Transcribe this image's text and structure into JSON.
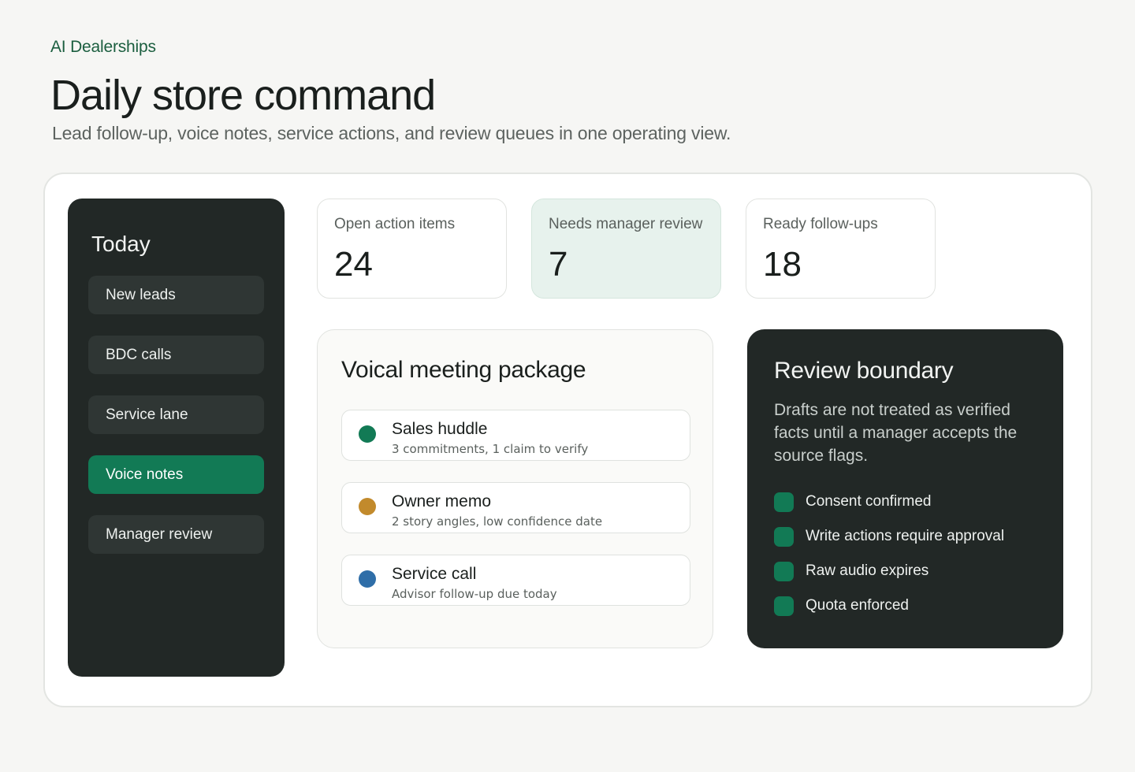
{
  "header": {
    "brand": "AI Dealerships",
    "title": "Daily store command",
    "subtitle": "Lead follow-up, voice notes, service actions, and review queues in one operating view."
  },
  "sidebar": {
    "title": "Today",
    "items": [
      {
        "label": "New leads",
        "active": false
      },
      {
        "label": "BDC calls",
        "active": false
      },
      {
        "label": "Service lane",
        "active": false
      },
      {
        "label": "Voice notes",
        "active": true
      },
      {
        "label": "Manager review",
        "active": false
      }
    ]
  },
  "metrics": [
    {
      "label": "Open action items",
      "value": "24"
    },
    {
      "label": "Needs manager review",
      "value": "7"
    },
    {
      "label": "Ready follow-ups",
      "value": "18"
    }
  ],
  "package": {
    "title": "Voical meeting package",
    "items": [
      {
        "name": "Sales huddle",
        "detail": "3 commitments, 1 claim to verify",
        "dot_color": "#127a55"
      },
      {
        "name": "Owner memo",
        "detail": "2 story angles, low confidence date",
        "dot_color": "#c28a2c"
      },
      {
        "name": "Service call",
        "detail": "Advisor follow-up due today",
        "dot_color": "#2f6ea8"
      }
    ]
  },
  "review": {
    "title": "Review boundary",
    "body": "Drafts are not treated as verified facts until a manager accepts the source flags.",
    "checks": [
      "Consent confirmed",
      "Write actions require approval",
      "Raw audio expires",
      "Quota enforced"
    ]
  },
  "colors": {
    "accent": "#127a55",
    "dark_panel": "#222826",
    "tint": "#e7f2ed"
  }
}
